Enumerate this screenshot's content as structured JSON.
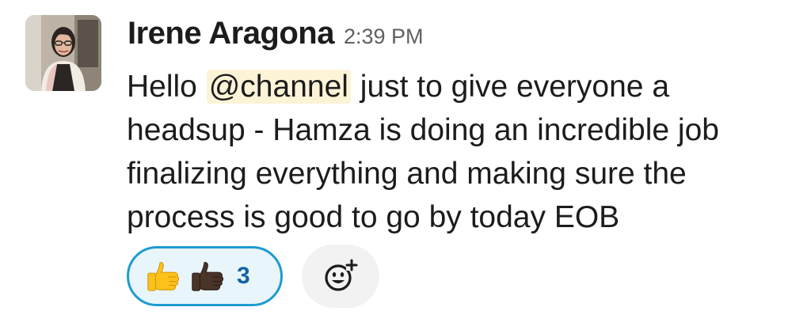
{
  "message": {
    "author": "Irene Aragona",
    "timestamp": "2:39 PM",
    "text": {
      "line1_before": "Hello",
      "mention": "@channel",
      "line1_after": "just to give everyone a",
      "line2": "headsup - Hamza is doing an incredible job",
      "line3": "finalizing everything and making sure the",
      "line4": "process is good to go by today EOB"
    }
  },
  "reactions": [
    {
      "emojis": [
        "thumbs-up-light-icon",
        "thumbs-up-dark-icon"
      ],
      "count": "3",
      "selected": true
    }
  ],
  "add_reaction": {
    "icon": "add-emoji-icon"
  },
  "colors": {
    "mention_bg": "#fdf3d7",
    "reaction_border": "#1d9bd1",
    "reaction_bg": "#e8f5fa",
    "reaction_count": "#1264a3",
    "timestamp": "#616061"
  }
}
